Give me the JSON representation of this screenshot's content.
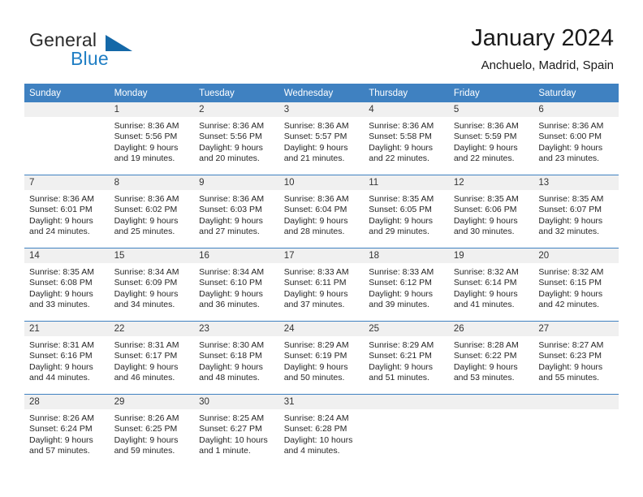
{
  "brand": {
    "name_part1": "General",
    "name_part2": "Blue",
    "triangle_color": "#1468a8",
    "blue_color": "#1f7ec4"
  },
  "header": {
    "title": "January 2024",
    "location": "Anchuelo, Madrid, Spain"
  },
  "theme": {
    "header_row_bg": "#3f81c1",
    "daynum_strip_bg": "#f0f0f0",
    "separator": "#3f81c1"
  },
  "calendar": {
    "weekday_headers": [
      "Sunday",
      "Monday",
      "Tuesday",
      "Wednesday",
      "Thursday",
      "Friday",
      "Saturday"
    ],
    "weeks": [
      [
        {
          "day": "",
          "empty": true
        },
        {
          "day": "1",
          "sunrise": "Sunrise: 8:36 AM",
          "sunset": "Sunset: 5:56 PM",
          "daylight_line1": "Daylight: 9 hours",
          "daylight_line2": "and 19 minutes."
        },
        {
          "day": "2",
          "sunrise": "Sunrise: 8:36 AM",
          "sunset": "Sunset: 5:56 PM",
          "daylight_line1": "Daylight: 9 hours",
          "daylight_line2": "and 20 minutes."
        },
        {
          "day": "3",
          "sunrise": "Sunrise: 8:36 AM",
          "sunset": "Sunset: 5:57 PM",
          "daylight_line1": "Daylight: 9 hours",
          "daylight_line2": "and 21 minutes."
        },
        {
          "day": "4",
          "sunrise": "Sunrise: 8:36 AM",
          "sunset": "Sunset: 5:58 PM",
          "daylight_line1": "Daylight: 9 hours",
          "daylight_line2": "and 22 minutes."
        },
        {
          "day": "5",
          "sunrise": "Sunrise: 8:36 AM",
          "sunset": "Sunset: 5:59 PM",
          "daylight_line1": "Daylight: 9 hours",
          "daylight_line2": "and 22 minutes."
        },
        {
          "day": "6",
          "sunrise": "Sunrise: 8:36 AM",
          "sunset": "Sunset: 6:00 PM",
          "daylight_line1": "Daylight: 9 hours",
          "daylight_line2": "and 23 minutes."
        }
      ],
      [
        {
          "day": "7",
          "sunrise": "Sunrise: 8:36 AM",
          "sunset": "Sunset: 6:01 PM",
          "daylight_line1": "Daylight: 9 hours",
          "daylight_line2": "and 24 minutes."
        },
        {
          "day": "8",
          "sunrise": "Sunrise: 8:36 AM",
          "sunset": "Sunset: 6:02 PM",
          "daylight_line1": "Daylight: 9 hours",
          "daylight_line2": "and 25 minutes."
        },
        {
          "day": "9",
          "sunrise": "Sunrise: 8:36 AM",
          "sunset": "Sunset: 6:03 PM",
          "daylight_line1": "Daylight: 9 hours",
          "daylight_line2": "and 27 minutes."
        },
        {
          "day": "10",
          "sunrise": "Sunrise: 8:36 AM",
          "sunset": "Sunset: 6:04 PM",
          "daylight_line1": "Daylight: 9 hours",
          "daylight_line2": "and 28 minutes."
        },
        {
          "day": "11",
          "sunrise": "Sunrise: 8:35 AM",
          "sunset": "Sunset: 6:05 PM",
          "daylight_line1": "Daylight: 9 hours",
          "daylight_line2": "and 29 minutes."
        },
        {
          "day": "12",
          "sunrise": "Sunrise: 8:35 AM",
          "sunset": "Sunset: 6:06 PM",
          "daylight_line1": "Daylight: 9 hours",
          "daylight_line2": "and 30 minutes."
        },
        {
          "day": "13",
          "sunrise": "Sunrise: 8:35 AM",
          "sunset": "Sunset: 6:07 PM",
          "daylight_line1": "Daylight: 9 hours",
          "daylight_line2": "and 32 minutes."
        }
      ],
      [
        {
          "day": "14",
          "sunrise": "Sunrise: 8:35 AM",
          "sunset": "Sunset: 6:08 PM",
          "daylight_line1": "Daylight: 9 hours",
          "daylight_line2": "and 33 minutes."
        },
        {
          "day": "15",
          "sunrise": "Sunrise: 8:34 AM",
          "sunset": "Sunset: 6:09 PM",
          "daylight_line1": "Daylight: 9 hours",
          "daylight_line2": "and 34 minutes."
        },
        {
          "day": "16",
          "sunrise": "Sunrise: 8:34 AM",
          "sunset": "Sunset: 6:10 PM",
          "daylight_line1": "Daylight: 9 hours",
          "daylight_line2": "and 36 minutes."
        },
        {
          "day": "17",
          "sunrise": "Sunrise: 8:33 AM",
          "sunset": "Sunset: 6:11 PM",
          "daylight_line1": "Daylight: 9 hours",
          "daylight_line2": "and 37 minutes."
        },
        {
          "day": "18",
          "sunrise": "Sunrise: 8:33 AM",
          "sunset": "Sunset: 6:12 PM",
          "daylight_line1": "Daylight: 9 hours",
          "daylight_line2": "and 39 minutes."
        },
        {
          "day": "19",
          "sunrise": "Sunrise: 8:32 AM",
          "sunset": "Sunset: 6:14 PM",
          "daylight_line1": "Daylight: 9 hours",
          "daylight_line2": "and 41 minutes."
        },
        {
          "day": "20",
          "sunrise": "Sunrise: 8:32 AM",
          "sunset": "Sunset: 6:15 PM",
          "daylight_line1": "Daylight: 9 hours",
          "daylight_line2": "and 42 minutes."
        }
      ],
      [
        {
          "day": "21",
          "sunrise": "Sunrise: 8:31 AM",
          "sunset": "Sunset: 6:16 PM",
          "daylight_line1": "Daylight: 9 hours",
          "daylight_line2": "and 44 minutes."
        },
        {
          "day": "22",
          "sunrise": "Sunrise: 8:31 AM",
          "sunset": "Sunset: 6:17 PM",
          "daylight_line1": "Daylight: 9 hours",
          "daylight_line2": "and 46 minutes."
        },
        {
          "day": "23",
          "sunrise": "Sunrise: 8:30 AM",
          "sunset": "Sunset: 6:18 PM",
          "daylight_line1": "Daylight: 9 hours",
          "daylight_line2": "and 48 minutes."
        },
        {
          "day": "24",
          "sunrise": "Sunrise: 8:29 AM",
          "sunset": "Sunset: 6:19 PM",
          "daylight_line1": "Daylight: 9 hours",
          "daylight_line2": "and 50 minutes."
        },
        {
          "day": "25",
          "sunrise": "Sunrise: 8:29 AM",
          "sunset": "Sunset: 6:21 PM",
          "daylight_line1": "Daylight: 9 hours",
          "daylight_line2": "and 51 minutes."
        },
        {
          "day": "26",
          "sunrise": "Sunrise: 8:28 AM",
          "sunset": "Sunset: 6:22 PM",
          "daylight_line1": "Daylight: 9 hours",
          "daylight_line2": "and 53 minutes."
        },
        {
          "day": "27",
          "sunrise": "Sunrise: 8:27 AM",
          "sunset": "Sunset: 6:23 PM",
          "daylight_line1": "Daylight: 9 hours",
          "daylight_line2": "and 55 minutes."
        }
      ],
      [
        {
          "day": "28",
          "sunrise": "Sunrise: 8:26 AM",
          "sunset": "Sunset: 6:24 PM",
          "daylight_line1": "Daylight: 9 hours",
          "daylight_line2": "and 57 minutes."
        },
        {
          "day": "29",
          "sunrise": "Sunrise: 8:26 AM",
          "sunset": "Sunset: 6:25 PM",
          "daylight_line1": "Daylight: 9 hours",
          "daylight_line2": "and 59 minutes."
        },
        {
          "day": "30",
          "sunrise": "Sunrise: 8:25 AM",
          "sunset": "Sunset: 6:27 PM",
          "daylight_line1": "Daylight: 10 hours",
          "daylight_line2": "and 1 minute."
        },
        {
          "day": "31",
          "sunrise": "Sunrise: 8:24 AM",
          "sunset": "Sunset: 6:28 PM",
          "daylight_line1": "Daylight: 10 hours",
          "daylight_line2": "and 4 minutes."
        },
        {
          "day": "",
          "empty": true
        },
        {
          "day": "",
          "empty": true
        },
        {
          "day": "",
          "empty": true
        }
      ]
    ]
  }
}
